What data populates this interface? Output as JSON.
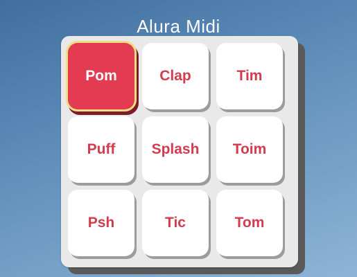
{
  "app": {
    "title": "Alura Midi"
  },
  "pads": [
    {
      "label": "Pom",
      "active": true
    },
    {
      "label": "Clap",
      "active": false
    },
    {
      "label": "Tim",
      "active": false
    },
    {
      "label": "Puff",
      "active": false
    },
    {
      "label": "Splash",
      "active": false
    },
    {
      "label": "Toim",
      "active": false
    },
    {
      "label": "Psh",
      "active": false
    },
    {
      "label": "Tic",
      "active": false
    },
    {
      "label": "Tom",
      "active": false
    }
  ],
  "colors": {
    "background_top": "#3f6e9f",
    "background_bottom": "#8db5d6",
    "pad_bg": "#ffffff",
    "pad_text": "#d33b4e",
    "pad_active_bg": "#e33b51",
    "pad_active_outline": "#f3dd82",
    "board_bg": "#e9e9e9"
  }
}
